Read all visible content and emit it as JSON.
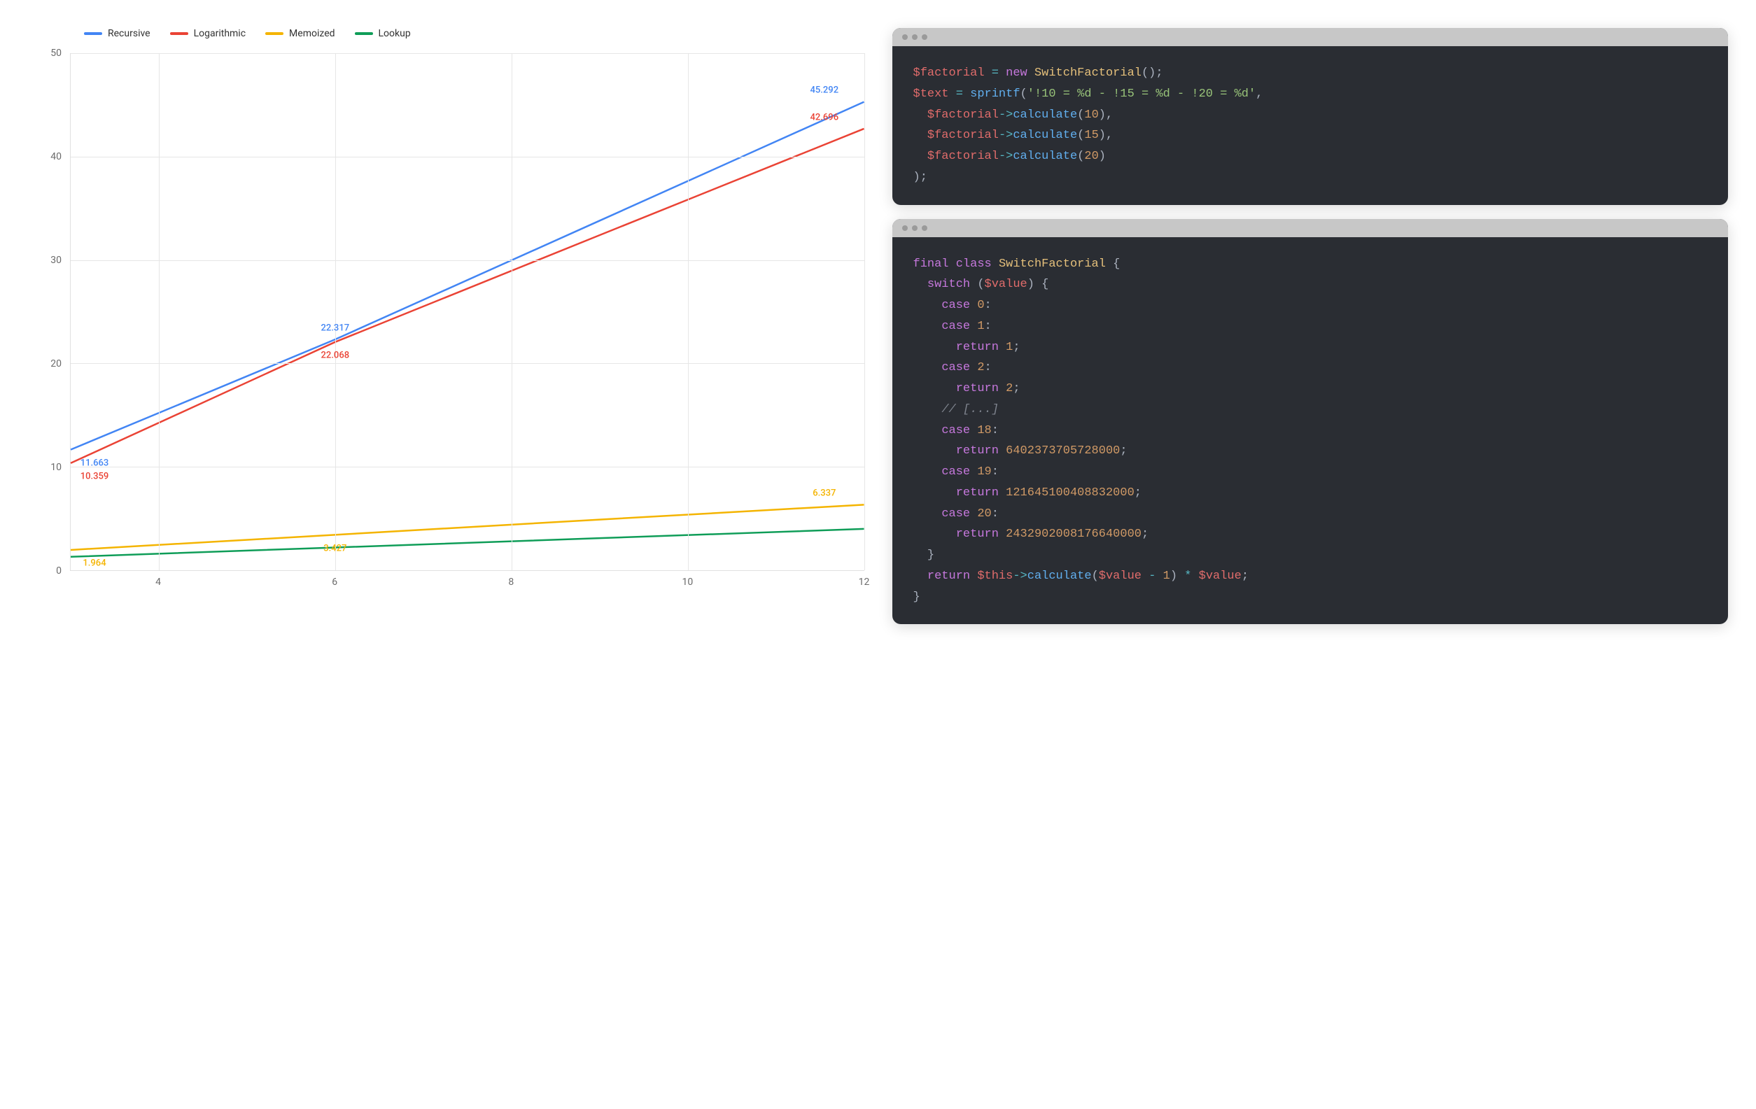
{
  "chart_data": {
    "type": "line",
    "x": [
      3,
      6,
      9,
      12
    ],
    "x_ticks": [
      4,
      6,
      8,
      10,
      12
    ],
    "y_ticks": [
      0,
      10,
      20,
      30,
      40,
      50
    ],
    "xlim": [
      3,
      12
    ],
    "ylim": [
      0,
      50
    ],
    "series": [
      {
        "name": "Recursive",
        "color": "#4285f4",
        "values": [
          11.663,
          22.317,
          33.8,
          45.292
        ],
        "labels": {
          "0": "11.663",
          "1": "22.317",
          "3": "45.292"
        }
      },
      {
        "name": "Logarithmic",
        "color": "#ea4335",
        "values": [
          10.359,
          22.068,
          32.4,
          42.696
        ],
        "labels": {
          "0": "10.359",
          "1": "22.068",
          "3": "42.696"
        }
      },
      {
        "name": "Memoized",
        "color": "#f4b400",
        "values": [
          1.964,
          3.427,
          4.9,
          6.337
        ],
        "labels": {
          "0": "1.964",
          "1": "3.427",
          "3": "6.337"
        }
      },
      {
        "name": "Lookup",
        "color": "#0f9d58",
        "values": [
          1.3,
          2.2,
          3.1,
          4.0
        ],
        "labels": {}
      }
    ],
    "legend": [
      "Recursive",
      "Logarithmic",
      "Memoized",
      "Lookup"
    ]
  },
  "code_blocks": {
    "block1": {
      "lines": [
        [
          [
            "$factorial",
            "var"
          ],
          [
            " ",
            "p"
          ],
          [
            "=",
            "op"
          ],
          [
            " ",
            "p"
          ],
          [
            "new",
            "kw"
          ],
          [
            " ",
            "p"
          ],
          [
            "SwitchFactorial",
            "type"
          ],
          [
            "();",
            "punct"
          ]
        ],
        [
          [
            "$text",
            "var"
          ],
          [
            " ",
            "p"
          ],
          [
            "=",
            "op"
          ],
          [
            " ",
            "p"
          ],
          [
            "sprintf",
            "fn"
          ],
          [
            "(",
            "punct"
          ],
          [
            "'!10 = %d - !15 = %d - !20 = %d'",
            "str"
          ],
          [
            ",",
            "punct"
          ]
        ],
        [
          [
            "  ",
            "p"
          ],
          [
            "$factorial",
            "var"
          ],
          [
            "->",
            "op"
          ],
          [
            "calculate",
            "fn"
          ],
          [
            "(",
            "punct"
          ],
          [
            "10",
            "num"
          ],
          [
            "),",
            "punct"
          ]
        ],
        [
          [
            "  ",
            "p"
          ],
          [
            "$factorial",
            "var"
          ],
          [
            "->",
            "op"
          ],
          [
            "calculate",
            "fn"
          ],
          [
            "(",
            "punct"
          ],
          [
            "15",
            "num"
          ],
          [
            "),",
            "punct"
          ]
        ],
        [
          [
            "  ",
            "p"
          ],
          [
            "$factorial",
            "var"
          ],
          [
            "->",
            "op"
          ],
          [
            "calculate",
            "fn"
          ],
          [
            "(",
            "punct"
          ],
          [
            "20",
            "num"
          ],
          [
            ")",
            "punct"
          ]
        ],
        [
          [
            ");",
            "punct"
          ]
        ]
      ]
    },
    "block2": {
      "lines": [
        [
          [
            "final",
            "kw"
          ],
          [
            " ",
            "p"
          ],
          [
            "class",
            "kw"
          ],
          [
            " ",
            "p"
          ],
          [
            "SwitchFactorial",
            "type"
          ],
          [
            " ",
            "p"
          ],
          [
            "{",
            "punct"
          ]
        ],
        [
          [
            "  ",
            "p"
          ],
          [
            "switch",
            "kw"
          ],
          [
            " (",
            "punct"
          ],
          [
            "$value",
            "var"
          ],
          [
            ") {",
            "punct"
          ]
        ],
        [
          [
            "    ",
            "p"
          ],
          [
            "case",
            "kw"
          ],
          [
            " ",
            "p"
          ],
          [
            "0",
            "num"
          ],
          [
            ":",
            "punct"
          ]
        ],
        [
          [
            "    ",
            "p"
          ],
          [
            "case",
            "kw"
          ],
          [
            " ",
            "p"
          ],
          [
            "1",
            "num"
          ],
          [
            ":",
            "punct"
          ]
        ],
        [
          [
            "      ",
            "p"
          ],
          [
            "return",
            "kw"
          ],
          [
            " ",
            "p"
          ],
          [
            "1",
            "num"
          ],
          [
            ";",
            "punct"
          ]
        ],
        [
          [
            "    ",
            "p"
          ],
          [
            "case",
            "kw"
          ],
          [
            " ",
            "p"
          ],
          [
            "2",
            "num"
          ],
          [
            ":",
            "punct"
          ]
        ],
        [
          [
            "      ",
            "p"
          ],
          [
            "return",
            "kw"
          ],
          [
            " ",
            "p"
          ],
          [
            "2",
            "num"
          ],
          [
            ";",
            "punct"
          ]
        ],
        [
          [
            "    ",
            "p"
          ],
          [
            "// [...]",
            "comment"
          ]
        ],
        [
          [
            "    ",
            "p"
          ],
          [
            "case",
            "kw"
          ],
          [
            " ",
            "p"
          ],
          [
            "18",
            "num"
          ],
          [
            ":",
            "punct"
          ]
        ],
        [
          [
            "      ",
            "p"
          ],
          [
            "return",
            "kw"
          ],
          [
            " ",
            "p"
          ],
          [
            "6402373705728000",
            "num"
          ],
          [
            ";",
            "punct"
          ]
        ],
        [
          [
            "    ",
            "p"
          ],
          [
            "case",
            "kw"
          ],
          [
            " ",
            "p"
          ],
          [
            "19",
            "num"
          ],
          [
            ":",
            "punct"
          ]
        ],
        [
          [
            "      ",
            "p"
          ],
          [
            "return",
            "kw"
          ],
          [
            " ",
            "p"
          ],
          [
            "121645100408832000",
            "num"
          ],
          [
            ";",
            "punct"
          ]
        ],
        [
          [
            "    ",
            "p"
          ],
          [
            "case",
            "kw"
          ],
          [
            " ",
            "p"
          ],
          [
            "20",
            "num"
          ],
          [
            ":",
            "punct"
          ]
        ],
        [
          [
            "      ",
            "p"
          ],
          [
            "return",
            "kw"
          ],
          [
            " ",
            "p"
          ],
          [
            "2432902008176640000",
            "num"
          ],
          [
            ";",
            "punct"
          ]
        ],
        [
          [
            "  ",
            "p"
          ],
          [
            "}",
            "punct"
          ]
        ],
        [
          [
            "  ",
            "p"
          ],
          [
            "return",
            "kw"
          ],
          [
            " ",
            "p"
          ],
          [
            "$this",
            "var"
          ],
          [
            "->",
            "op"
          ],
          [
            "calculate",
            "fn"
          ],
          [
            "(",
            "punct"
          ],
          [
            "$value",
            "var"
          ],
          [
            " ",
            "p"
          ],
          [
            "-",
            "op"
          ],
          [
            " ",
            "p"
          ],
          [
            "1",
            "num"
          ],
          [
            ") ",
            "punct"
          ],
          [
            "*",
            "op"
          ],
          [
            " ",
            "p"
          ],
          [
            "$value",
            "var"
          ],
          [
            ";",
            "punct"
          ]
        ],
        [
          [
            "}",
            "punct"
          ]
        ]
      ]
    }
  }
}
